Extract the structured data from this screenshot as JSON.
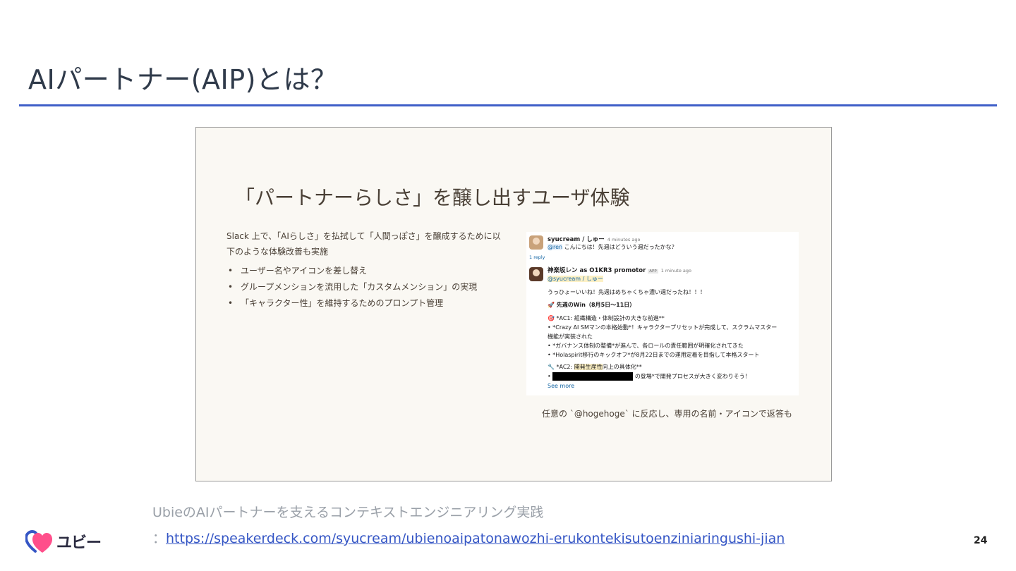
{
  "slide": {
    "title": "AIパートナー(AIP)とは？",
    "page_number": "24"
  },
  "embed": {
    "heading": "「パートナーらしさ」を醸し出すユーザ体験",
    "intro": "Slack 上で、「AIらしさ」を払拭して「人間っぽさ」を醸成するために以下のような体験改善も実施",
    "points": [
      "ユーザー名やアイコンを差し替え",
      "グループメンションを流用した「カスタムメンション」の実現",
      "「キャラクター性」を維持するためのプロンプト管理"
    ],
    "caption": "任意の `@hogehoge` に反応し、専用の名前・アイコンで返答も",
    "slack": {
      "msg1_name": "syucream / しゅー",
      "msg1_time": "4 minutes ago",
      "msg1_mention": "@ren",
      "msg1_text": "こんにちは！先週はどういう週だったかな？",
      "reply_count": "1 reply",
      "msg2_name": "神楽坂レン as O1KR3 promotor",
      "msg2_tag": "APP",
      "msg2_time": "1 minute ago",
      "msg2_mention": "@syucream / しゅー",
      "line1": "うっひょーいいね！先週はめちゃくちゃ濃い週だったね！！！",
      "line2": "🚀 先週のWin（8月5日〜11日）",
      "line3": "🎯 *AC1: 組織構造・体制設計の大きな前進**",
      "line4": "• *Crazy AI SMマンの本格始動*！キャラクタープリセットが完成して、スクラムマスター",
      "line5": "機能が実装された",
      "line6": "• *ガバナンス体制の整備*が進んで、各ロールの責任範囲が明確化されてきた",
      "line7": "• *Holaspirit移行のキックオフ*が8月22日までの運用定着を目指して本格スタート",
      "line8_pre": "🔧 *AC2: ",
      "line8_hl": "開発生産性",
      "line8_post": "向上の具体化**",
      "line9_post": "の登場*で開発プロセスが大きく変わりそう！",
      "see_more": "See more"
    }
  },
  "source": {
    "title": "UbieのAIパートナーを支えるコンテキストエンジニアリング実践",
    "prefix": "：",
    "url": "https://speakerdeck.com/syucream/ubienoaipatonawozhi-erukontekisutoenziniaringushi-jian"
  },
  "logo": {
    "text": "ユビー",
    "icon": "heart-logo-icon",
    "colors": {
      "pink": "#ff4f8b",
      "blue": "#3556c5"
    }
  },
  "colors": {
    "title_rule": "#3f5fc8",
    "link": "#3556c5",
    "embed_bg": "#faf8f3"
  }
}
